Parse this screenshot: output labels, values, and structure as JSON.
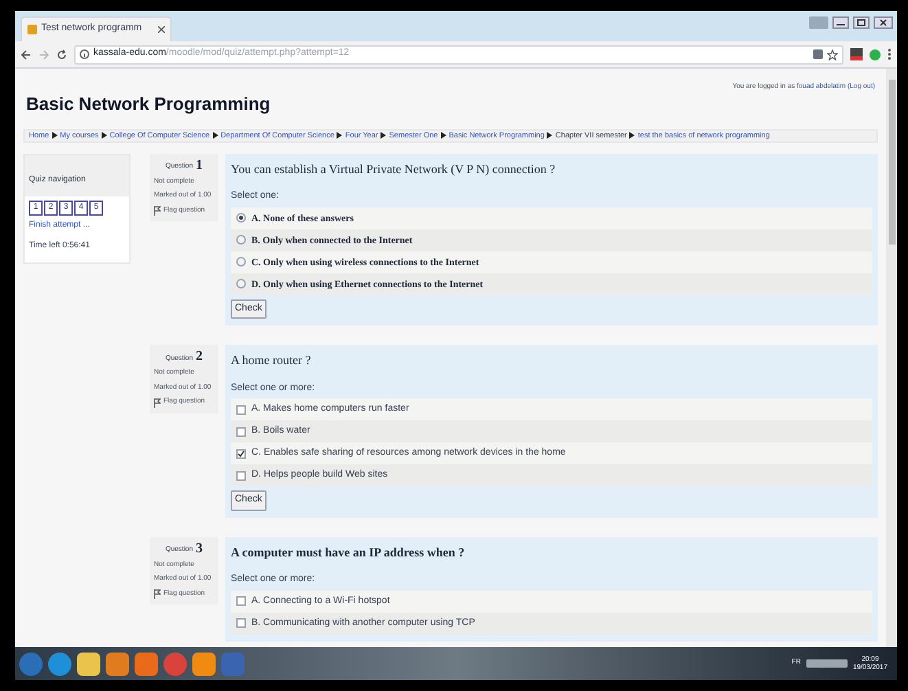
{
  "browser": {
    "tab_title": "Test network programm",
    "url_host": "kassala-edu.com",
    "url_path": "/moodle/mod/quiz/attempt.php?attempt=12"
  },
  "page": {
    "title": "Basic Network Programming",
    "login": {
      "prefix": "You are logged in as",
      "user": "fouad abdelatim",
      "logout": "(Log out)"
    },
    "breadcrumb": [
      {
        "label": "Home",
        "link": true
      },
      {
        "label": "My courses",
        "link": true
      },
      {
        "label": "College Of Computer Science",
        "link": true
      },
      {
        "label": "Department Of Computer Science",
        "link": true
      },
      {
        "label": "Four Year",
        "link": true
      },
      {
        "label": "Semester One",
        "link": true
      },
      {
        "label": "Basic Network Programming",
        "link": true
      },
      {
        "label": "Chapter VII semester",
        "link": false
      },
      {
        "label": "test the basics of network programming",
        "link": true
      }
    ]
  },
  "quiz_navigation": {
    "title": "Quiz navigation",
    "buttons": [
      "1",
      "2",
      "3",
      "4",
      "5"
    ],
    "finish": "Finish attempt ...",
    "time_left": "Time left 0:56:41"
  },
  "questions": [
    {
      "label": "Question",
      "number": "1",
      "status": "Not complete",
      "marks": "Marked out of 1.00",
      "flag": "Flag question",
      "text": "You can establish a Virtual Private Network (V P N) connection ?",
      "text_bold": false,
      "instruction": "Select one:",
      "kind": "radio",
      "options_bold": true,
      "options": [
        {
          "label": "A. None of these answers",
          "checked": true
        },
        {
          "label": "B.  Only when connected to the Internet",
          "checked": false
        },
        {
          "label": "C. Only when using wireless connections to the Internet",
          "checked": false
        },
        {
          "label": "D. Only when using Ethernet connections to the Internet",
          "checked": false
        }
      ],
      "check": "Check"
    },
    {
      "label": "Question",
      "number": "2",
      "status": "Not complete",
      "marks": "Marked out of 1.00",
      "flag": "Flag question",
      "text": "A home router ?",
      "text_bold": false,
      "instruction": "Select one or more:",
      "kind": "checkbox",
      "options_bold": false,
      "options": [
        {
          "label": "A. Makes home computers run faster",
          "checked": false
        },
        {
          "label": "B. Boils water",
          "checked": false
        },
        {
          "label": "C. Enables safe sharing of resources among network devices in the home",
          "checked": true
        },
        {
          "label": "D. Helps people build Web sites",
          "checked": false
        }
      ],
      "check": "Check"
    },
    {
      "label": "Question",
      "number": "3",
      "status": "Not complete",
      "marks": "Marked out of 1.00",
      "flag": "Flag question",
      "text": "A computer must have an IP address when ?",
      "text_bold": true,
      "instruction": "Select one or more:",
      "kind": "checkbox",
      "options_bold": false,
      "options": [
        {
          "label": "A. Connecting to a Wi-Fi hotspot",
          "checked": false
        },
        {
          "label": "B. Communicating with another computer using TCP",
          "checked": false
        }
      ]
    }
  ],
  "taskbar": {
    "language": "FR",
    "time": "20:09",
    "date": "19/03/2017"
  }
}
